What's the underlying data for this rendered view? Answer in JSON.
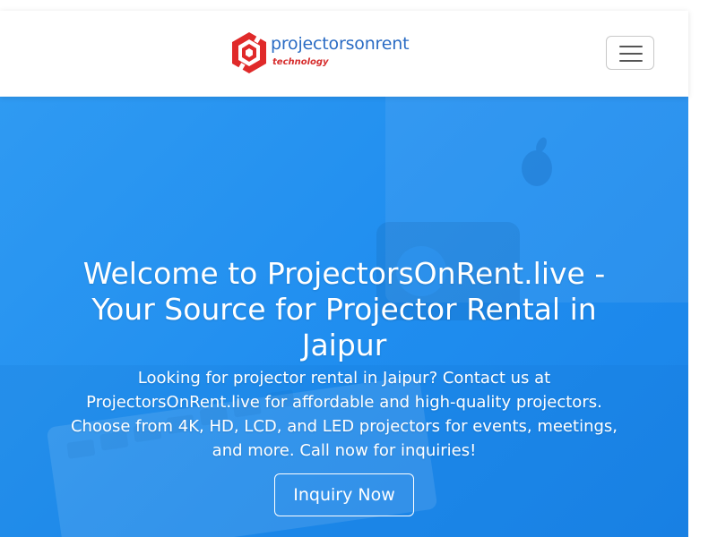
{
  "brand": {
    "name": "projectorsonrent",
    "tagline": "technology",
    "colors": {
      "name": "#2b6cc4",
      "logo": "#e02a2a"
    }
  },
  "navbar": {
    "toggle_icon": "hamburger-menu-icon"
  },
  "hero": {
    "title": "Welcome to ProjectorsOnRent.live - Your Source for Projector Rental in Jaipur",
    "description": "Looking for projector rental in Jaipur? Contact us at ProjectorsOnRent.live for affordable and high-quality projectors. Choose from 4K, HD, LCD, and LED projectors for events, meetings, and more. Call now for inquiries!",
    "cta_label": "Inquiry Now",
    "background_color": "#2196f3"
  }
}
